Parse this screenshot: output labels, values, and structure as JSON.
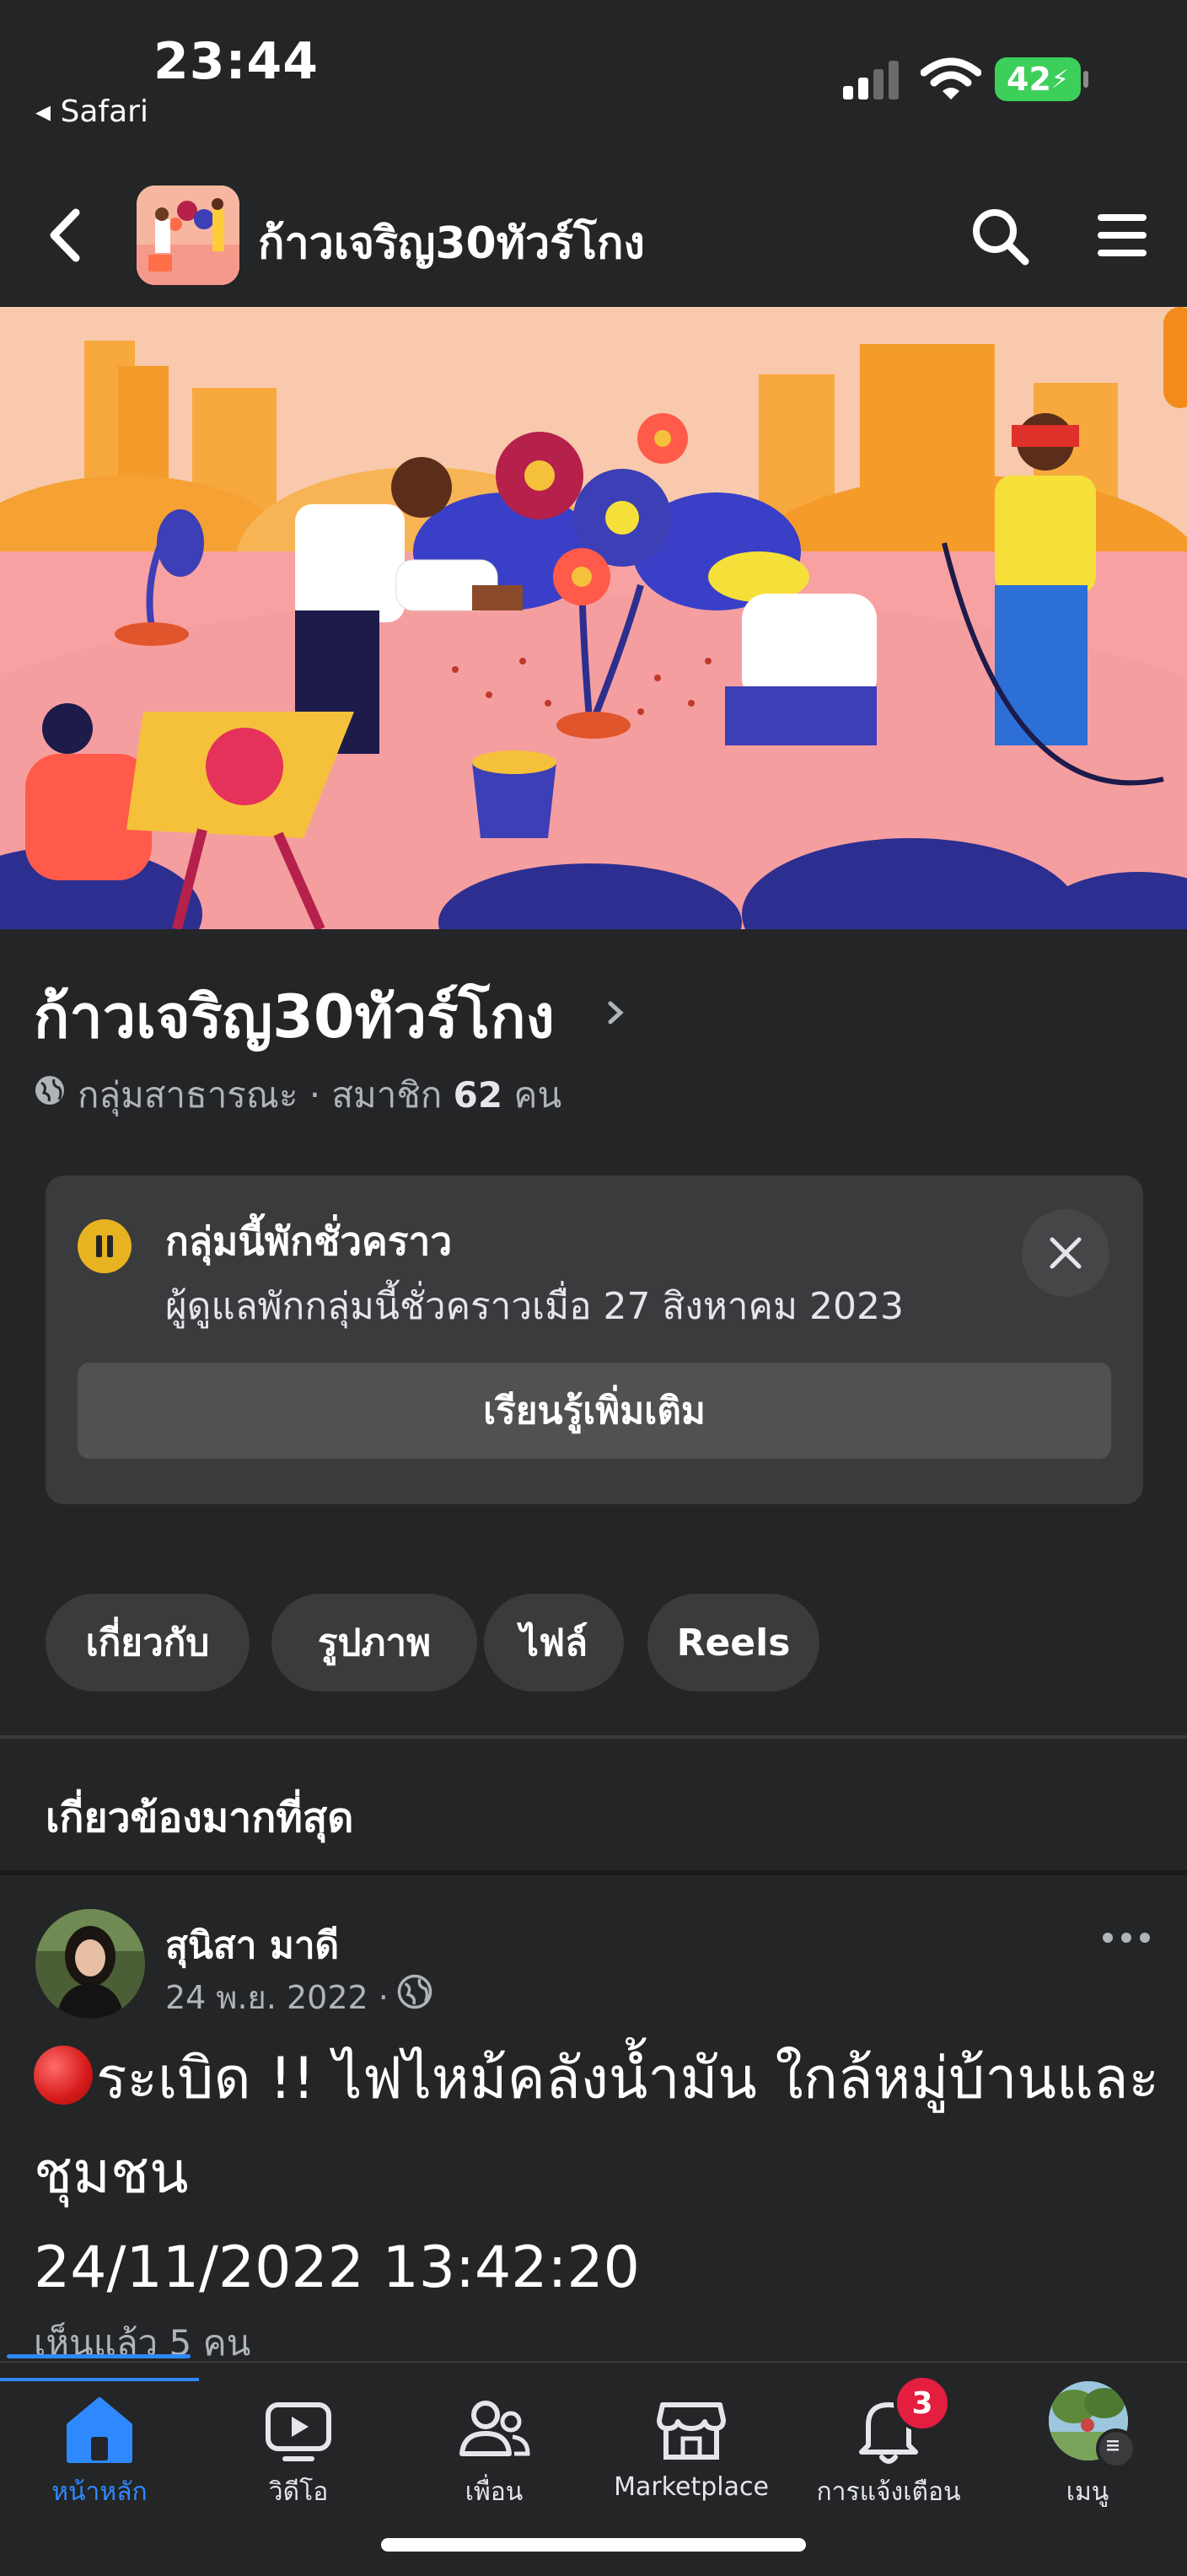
{
  "status_bar": {
    "time": "23:44",
    "back_app": "◂ Safari",
    "battery": "42"
  },
  "header": {
    "title": "ก้าวเจริญ30ทัวร์โกง"
  },
  "group": {
    "name": "ก้าวเจริญ30ทัวร์โกง",
    "meta_prefix": "กลุ่มสาธารณะ · สมาชิก ",
    "member_count": "62",
    "meta_suffix": " คน"
  },
  "pause_notice": {
    "title": "กลุ่มนี้พักชั่วคราว",
    "description": "ผู้ดูแลพักกลุ่มนี้ชั่วคราวเมื่อ 27 สิงหาคม  2023",
    "learn_more": "เรียนรู้เพิ่มเติม"
  },
  "tabs": [
    {
      "label": "เกี่ยวกับ"
    },
    {
      "label": "รูปภาพ"
    },
    {
      "label": "ไฟล์"
    },
    {
      "label": "Reels"
    }
  ],
  "section": {
    "title": "เกี่ยวข้องมากที่สุด"
  },
  "post": {
    "author": "สุนิสา มาดี",
    "date": "24 พ.ย. 2022 ·",
    "text": "ระเบิด !! ไฟไหม้คลังน้ำมัน ใกล้หมู่บ้านและชุมชน",
    "timestamp": "24/11/2022  13:42:20",
    "seen": "เห็นแล้ว 5 คน"
  },
  "bottom_nav": {
    "items": [
      {
        "label": "หน้าหลัก",
        "icon": "home-icon",
        "active": true
      },
      {
        "label": "วิดีโอ",
        "icon": "video-icon"
      },
      {
        "label": "เพื่อน",
        "icon": "friends-icon"
      },
      {
        "label": "Marketplace",
        "icon": "marketplace-icon"
      },
      {
        "label": "การแจ้งเตือน",
        "icon": "bell-icon"
      },
      {
        "label": "เมนู",
        "icon": "avatar"
      }
    ],
    "notifications_badge": "3"
  },
  "colors": {
    "accent": "#2e89ff",
    "background": "#242526",
    "card": "#3a3b3c",
    "pause": "#e8b321",
    "badge": "#e41e3f"
  }
}
